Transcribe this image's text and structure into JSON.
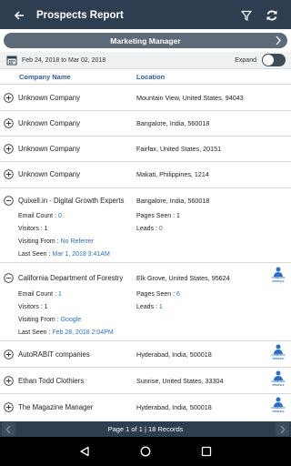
{
  "header": {
    "title": "Prospects Report"
  },
  "segment": {
    "label": "Marketing Manager"
  },
  "filter": {
    "date_range": "Feb 24, 2018 to Mar 02, 2018",
    "expand_label": "Expand"
  },
  "columns": {
    "company": "Company Name",
    "location": "Location"
  },
  "rows": [
    {
      "company": "Unknown Company",
      "location": "Mountain View, United States, 94043"
    },
    {
      "company": "Unknown Company",
      "location": "Bangalore, India, 560018"
    },
    {
      "company": "Unknown Company",
      "location": "Fairfax, United States, 20151"
    },
    {
      "company": "Unknown Company",
      "location": "Makati, Philippines, 1214"
    },
    {
      "company": "Quixell.in - Digital Growth Experts",
      "location": "Bangalore, India, 560018",
      "email_count_label": "Email Count :",
      "email_count": "0",
      "pages_seen_label": "Pages Seen :",
      "pages_seen": "1",
      "visitors_label": "Visitors :",
      "visitors": "1",
      "leads_label": "Leads :",
      "leads": "0",
      "visiting_from_label": "Visiting From :",
      "visiting_from": "No Referrer",
      "last_seen_label": "Last Seen :",
      "last_seen": "Mar 1, 2018 3:41AM"
    },
    {
      "company": "California Department of Forestry",
      "location": "Elk Grove, United States, 95624",
      "email_count_label": "Email Count :",
      "email_count": "1",
      "pages_seen_label": "Pages Seen :",
      "pages_seen": "6",
      "visitors_label": "Visitors :",
      "visitors": "1",
      "leads_label": "Leads :",
      "leads": "1",
      "visiting_from_label": "Visiting From :",
      "visiting_from": "Google",
      "last_seen_label": "Last Seen :",
      "last_seen": "Feb 28, 2018 2:04PM",
      "profile_label": "COMPANY PROFILE"
    },
    {
      "company": "AutoRABIT companies",
      "location": "Hyderabad, India, 500018",
      "profile_label": "COMPANY PROFILE"
    },
    {
      "company": "Ethan Todd Clothiers",
      "location": "Sunrise, United States, 33304",
      "profile_label": "COMPANY PROFILE"
    },
    {
      "company": "The Magazine Manager",
      "location": "Hyderabad, India, 500018",
      "profile_label": "COMPANY PROFILE"
    }
  ],
  "pager": {
    "text": "Page 1 of 1 | 18 Records"
  },
  "colors": {
    "appbar": "#2c3e50",
    "segment": "#5d6b78",
    "accent": "#2a6fc4",
    "header_text": "#2d5d9f"
  }
}
